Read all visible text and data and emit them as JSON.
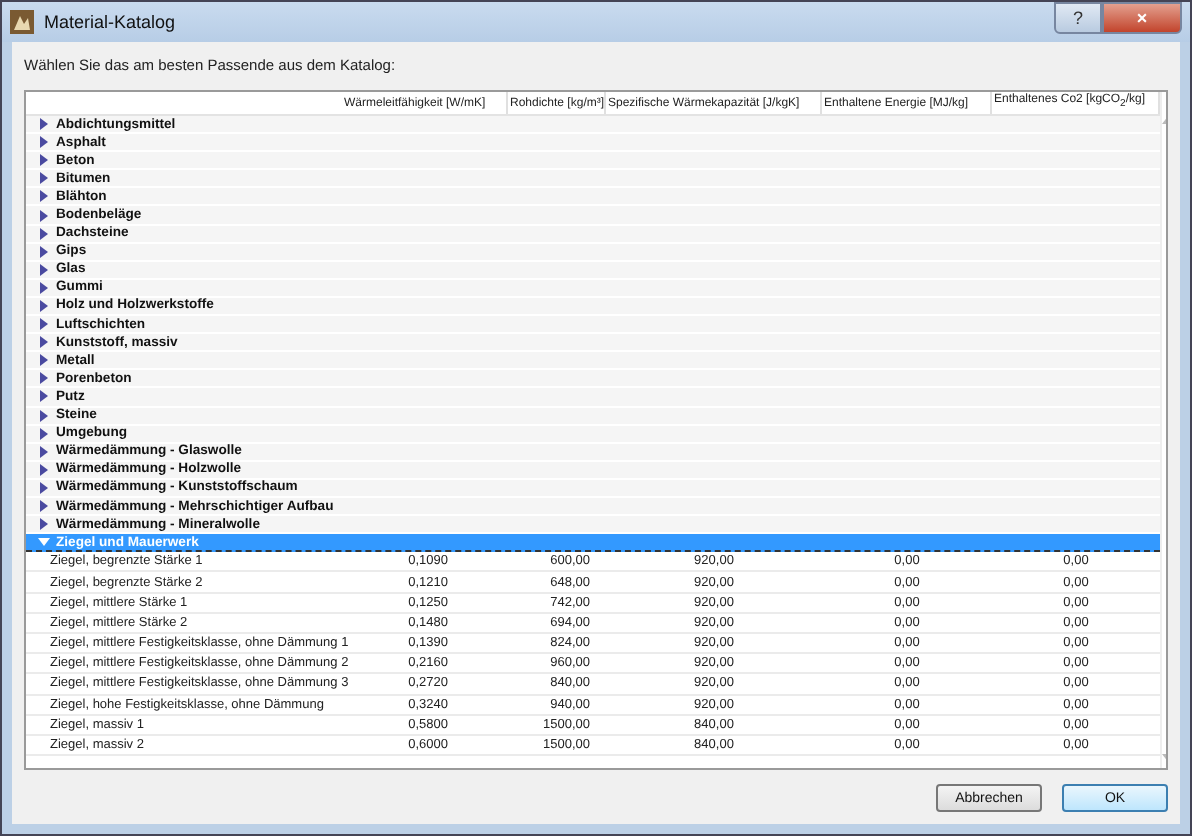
{
  "window": {
    "title": "Material-Katalog",
    "buttons": [
      "?",
      "×"
    ]
  },
  "prompt": "Wählen Sie das am besten Passende aus dem Katalog:",
  "table": {
    "columns": [
      "",
      "Wärmeleitfähigkeit [W/mK]",
      "Rohdichte [kg/m³]",
      "Spezifische Wärmekapazität [J/kgK]",
      "Enthaltene Energie [MJ/kg]",
      "Enthaltenes Co2 [kgCO$_{2}$/kg]"
    ],
    "groups": [
      {
        "label": "Abdichtungsmittel",
        "expanded": false,
        "selected": false
      },
      {
        "label": "Asphalt",
        "expanded": false,
        "selected": false
      },
      {
        "label": "Beton",
        "expanded": false,
        "selected": false
      },
      {
        "label": "Bitumen",
        "expanded": false,
        "selected": false
      },
      {
        "label": "Blähton",
        "expanded": false,
        "selected": false
      },
      {
        "label": "Bodenbeläge",
        "expanded": false,
        "selected": false
      },
      {
        "label": "Dachsteine",
        "expanded": false,
        "selected": false
      },
      {
        "label": "Gips",
        "expanded": false,
        "selected": false
      },
      {
        "label": "Glas",
        "expanded": false,
        "selected": false
      },
      {
        "label": "Gummi",
        "expanded": false,
        "selected": false
      },
      {
        "label": "Holz und Holzwerkstoffe",
        "expanded": false,
        "selected": false
      },
      {
        "label": "Luftschichten",
        "expanded": false,
        "selected": false
      },
      {
        "label": "Kunststoff, massiv",
        "expanded": false,
        "selected": false
      },
      {
        "label": "Metall",
        "expanded": false,
        "selected": false
      },
      {
        "label": "Porenbeton",
        "expanded": false,
        "selected": false
      },
      {
        "label": "Putz",
        "expanded": false,
        "selected": false
      },
      {
        "label": "Steine",
        "expanded": false,
        "selected": false
      },
      {
        "label": "Umgebung",
        "expanded": false,
        "selected": false
      },
      {
        "label": "Wärmedämmung - Glaswolle",
        "expanded": false,
        "selected": false
      },
      {
        "label": "Wärmedämmung - Holzwolle",
        "expanded": false,
        "selected": false
      },
      {
        "label": "Wärmedämmung - Kunststoffschaum",
        "expanded": false,
        "selected": false
      },
      {
        "label": "Wärmedämmung - Mehrschichtiger Aufbau",
        "expanded": false,
        "selected": false
      },
      {
        "label": "Wärmedämmung - Mineralwolle",
        "expanded": false,
        "selected": false
      },
      {
        "label": "Ziegel und Mauerwerk",
        "expanded": true,
        "selected": true,
        "children": [
          {
            "cells": [
              "Ziegel, begrenzte Stärke 1",
              "0,1090",
              "600,00",
              "920,00",
              "0,00",
              "0,00"
            ]
          },
          {
            "cells": [
              "Ziegel, begrenzte Stärke 2",
              "0,1210",
              "648,00",
              "920,00",
              "0,00",
              "0,00"
            ]
          },
          {
            "cells": [
              "Ziegel, mittlere Stärke 1",
              "0,1250",
              "742,00",
              "920,00",
              "0,00",
              "0,00"
            ]
          },
          {
            "cells": [
              "Ziegel, mittlere Stärke 2",
              "0,1480",
              "694,00",
              "920,00",
              "0,00",
              "0,00"
            ]
          },
          {
            "cells": [
              "Ziegel, mittlere Festigkeitsklasse, ohne Dämmung 1",
              "0,1390",
              "824,00",
              "920,00",
              "0,00",
              "0,00"
            ]
          },
          {
            "cells": [
              "Ziegel, mittlere Festigkeitsklasse, ohne Dämmung 2",
              "0,2160",
              "960,00",
              "920,00",
              "0,00",
              "0,00"
            ]
          },
          {
            "cells": [
              "Ziegel, mittlere Festigkeitsklasse, ohne Dämmung 3",
              "0,2720",
              "840,00",
              "920,00",
              "0,00",
              "0,00"
            ]
          },
          {
            "cells": [
              "Ziegel, hohe Festigkeitsklasse, ohne Dämmung",
              "0,3240",
              "940,00",
              "920,00",
              "0,00",
              "0,00"
            ]
          },
          {
            "cells": [
              "Ziegel, massiv 1",
              "0,5800",
              "1500,00",
              "840,00",
              "0,00",
              "0,00"
            ]
          },
          {
            "cells": [
              "Ziegel, massiv 2",
              "0,6000",
              "1500,00",
              "840,00",
              "0,00",
              "0,00"
            ]
          }
        ]
      }
    ]
  },
  "buttons": [
    {
      "label": "Abbrechen",
      "kind": "normal"
    },
    {
      "label": "OK",
      "kind": "default"
    }
  ]
}
